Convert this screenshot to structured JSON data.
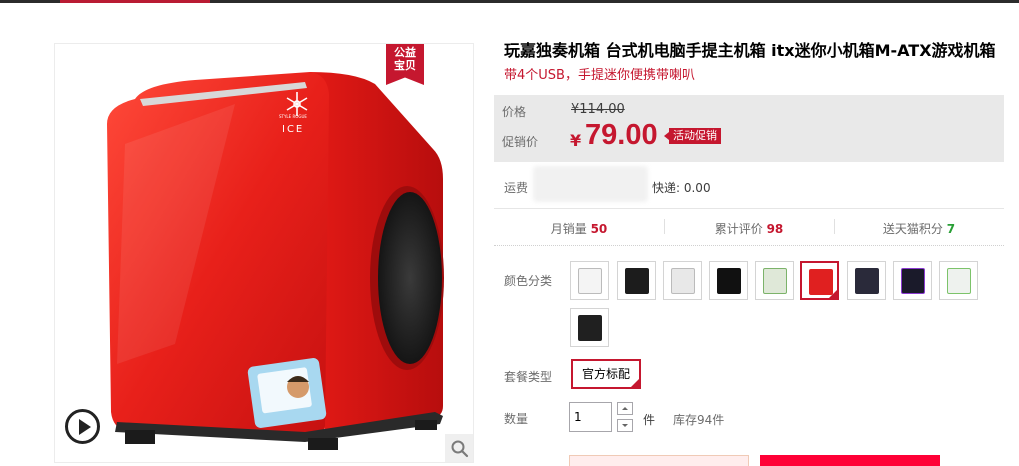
{
  "product": {
    "title": "玩嘉独奏机箱 台式机电脑手提主机箱 itx迷你小机箱M-ATX游戏机箱",
    "subtitle": "带4个USB，手提迷你便携带喇叭",
    "promo_tag": {
      "line1": "公益",
      "line2": "宝贝"
    },
    "case_brand_text": "ICE",
    "case_small_text": "STYLE ROGUE"
  },
  "price": {
    "label": "价格",
    "original": "¥114.00",
    "promo_label": "促销价",
    "currency": "¥",
    "current": "79.00",
    "promo_badge": "活动促销"
  },
  "shipping": {
    "label": "运费",
    "text": "快递: 0.00"
  },
  "stats": [
    {
      "label": "月销量",
      "value": "50",
      "color": "#c5172f"
    },
    {
      "label": "累计评价",
      "value": "98",
      "color": "#c5172f"
    },
    {
      "label": "送天猫积分",
      "value": "7",
      "color": "#289f35"
    }
  ],
  "sku": {
    "color_label": "颜色分类",
    "swatches": [
      {
        "name": "white",
        "color": "#f4f4f4",
        "selected": false
      },
      {
        "name": "black-white",
        "color": "#1c1c1c",
        "selected": false
      },
      {
        "name": "white-2",
        "color": "#e8e8e8",
        "selected": false
      },
      {
        "name": "black",
        "color": "#111111",
        "selected": false
      },
      {
        "name": "white-green",
        "color": "#dfe8d8",
        "selected": false
      },
      {
        "name": "red",
        "color": "#e02020",
        "selected": true
      },
      {
        "name": "black-window",
        "color": "#2a2a3a",
        "selected": false
      },
      {
        "name": "black-rgb",
        "color": "#1a1a2a",
        "selected": false
      },
      {
        "name": "white-window",
        "color": "#eef2ee",
        "selected": false
      },
      {
        "name": "black-plain",
        "color": "#202020",
        "selected": false
      }
    ],
    "package_label": "套餐类型",
    "package_option": "官方标配"
  },
  "quantity": {
    "label": "数量",
    "value": "1",
    "unit": "件",
    "stock": "库存94件"
  },
  "icons": {
    "play": "play-icon",
    "zoom": "search-icon"
  },
  "colors": {
    "brand_red": "#c5172f",
    "case_red": "#e02020"
  }
}
